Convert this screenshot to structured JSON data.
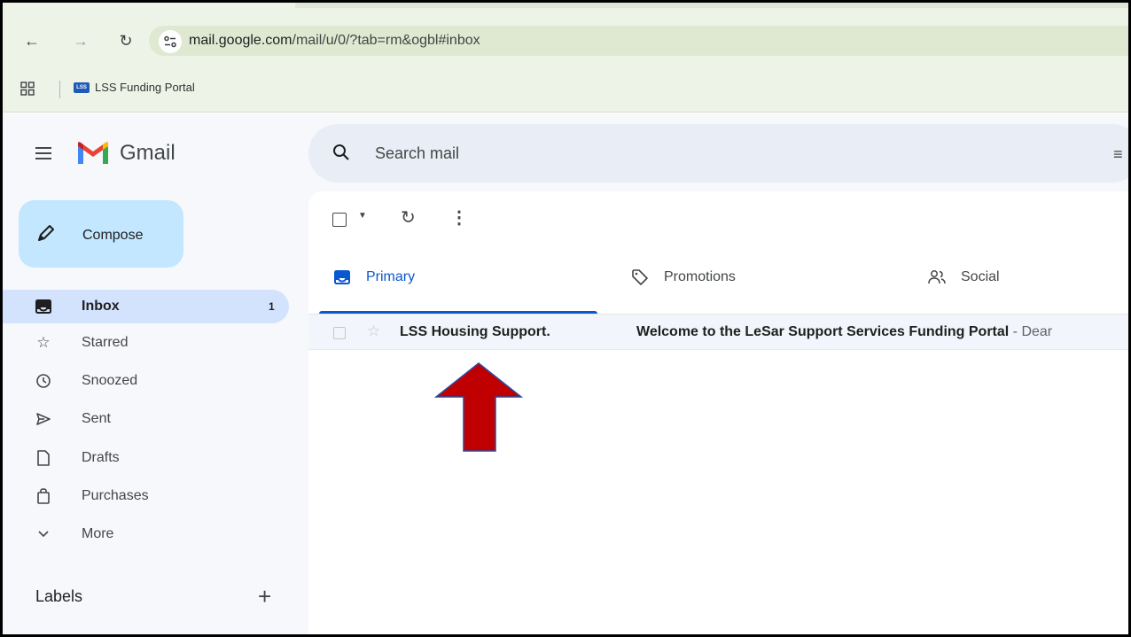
{
  "browser": {
    "url_host": "mail.google.com",
    "url_path": "/mail/u/0/?tab=rm&ogbl#inbox",
    "bookmark_label": "LSS Funding Portal",
    "bookmark_favicon_text": "LSS"
  },
  "gmail": {
    "logo_text": "Gmail",
    "search_placeholder": "Search mail",
    "compose_label": "Compose",
    "nav": [
      {
        "label": "Inbox",
        "count": "1",
        "icon": "inbox-icon"
      },
      {
        "label": "Starred",
        "icon": "star-icon"
      },
      {
        "label": "Snoozed",
        "icon": "clock-icon"
      },
      {
        "label": "Sent",
        "icon": "send-icon"
      },
      {
        "label": "Drafts",
        "icon": "draft-icon"
      },
      {
        "label": "Purchases",
        "icon": "shopping-bag-icon"
      },
      {
        "label": "More",
        "icon": "chevron-down-icon"
      }
    ],
    "labels_heading": "Labels",
    "labels_add_symbol": "+",
    "tabs": [
      {
        "label": "Primary",
        "icon": "inbox-tab-icon"
      },
      {
        "label": "Promotions",
        "icon": "tag-icon"
      },
      {
        "label": "Social",
        "icon": "people-icon"
      }
    ],
    "emails": [
      {
        "sender": "LSS Housing Support.",
        "subject": "Welcome to the LeSar Support Services Funding Portal",
        "snippet": " - Dear"
      }
    ]
  },
  "annotation": {
    "arrow_color": "#c00000",
    "arrow_outline": "#2b4aa0"
  }
}
